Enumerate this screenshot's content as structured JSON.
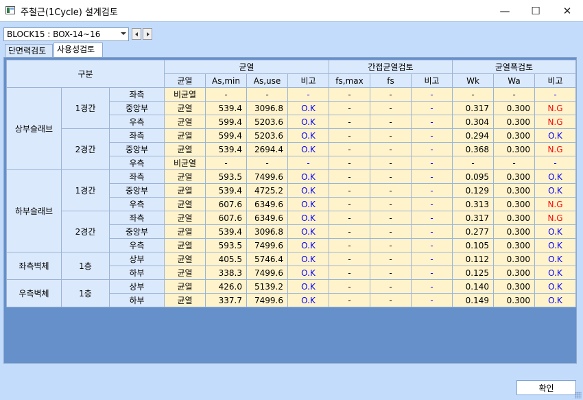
{
  "window": {
    "title": "주철근(1Cycle) 설계검토",
    "minimize": "—",
    "maximize": "☐",
    "close": "✕"
  },
  "block_select": {
    "value": "BLOCK15 : BOX-14~16"
  },
  "tabs": [
    "단면력검토",
    "사용성검토"
  ],
  "active_tab": 1,
  "headers": {
    "division": "구분",
    "crack": "균열",
    "indirect": "간접균열검토",
    "width": "균열폭검토",
    "sub": [
      "균열",
      "As,min",
      "As,use",
      "비고",
      "fs,max",
      "fs",
      "비고",
      "Wk",
      "Wa",
      "비고"
    ]
  },
  "groups": [
    {
      "name": "상부슬래브",
      "spans": [
        {
          "name": "1경간",
          "rows": [
            {
              "loc": "좌측",
              "c": "비균열",
              "asmin": "-",
              "asuse": "-",
              "r1": "-",
              "fsmax": "-",
              "fs": "-",
              "r2": "-",
              "wk": "-",
              "wa": "-",
              "r3": "-"
            },
            {
              "loc": "중앙부",
              "c": "균열",
              "asmin": "539.4",
              "asuse": "3096.8",
              "r1": "O.K",
              "fsmax": "-",
              "fs": "-",
              "r2": "-",
              "wk": "0.317",
              "wa": "0.300",
              "r3": "N.G"
            },
            {
              "loc": "우측",
              "c": "균열",
              "asmin": "599.4",
              "asuse": "5203.6",
              "r1": "O.K",
              "fsmax": "-",
              "fs": "-",
              "r2": "-",
              "wk": "0.304",
              "wa": "0.300",
              "r3": "N.G"
            }
          ]
        },
        {
          "name": "2경간",
          "rows": [
            {
              "loc": "좌측",
              "c": "균열",
              "asmin": "599.4",
              "asuse": "5203.6",
              "r1": "O.K",
              "fsmax": "-",
              "fs": "-",
              "r2": "-",
              "wk": "0.294",
              "wa": "0.300",
              "r3": "O.K"
            },
            {
              "loc": "중앙부",
              "c": "균열",
              "asmin": "539.4",
              "asuse": "2694.4",
              "r1": "O.K",
              "fsmax": "-",
              "fs": "-",
              "r2": "-",
              "wk": "0.368",
              "wa": "0.300",
              "r3": "N.G"
            },
            {
              "loc": "우측",
              "c": "비균열",
              "asmin": "-",
              "asuse": "-",
              "r1": "-",
              "fsmax": "-",
              "fs": "-",
              "r2": "-",
              "wk": "-",
              "wa": "-",
              "r3": "-"
            }
          ]
        }
      ]
    },
    {
      "name": "하부슬래브",
      "spans": [
        {
          "name": "1경간",
          "rows": [
            {
              "loc": "좌측",
              "c": "균열",
              "asmin": "593.5",
              "asuse": "7499.6",
              "r1": "O.K",
              "fsmax": "-",
              "fs": "-",
              "r2": "-",
              "wk": "0.095",
              "wa": "0.300",
              "r3": "O.K"
            },
            {
              "loc": "중앙부",
              "c": "균열",
              "asmin": "539.4",
              "asuse": "4725.2",
              "r1": "O.K",
              "fsmax": "-",
              "fs": "-",
              "r2": "-",
              "wk": "0.129",
              "wa": "0.300",
              "r3": "O.K"
            },
            {
              "loc": "우측",
              "c": "균열",
              "asmin": "607.6",
              "asuse": "6349.6",
              "r1": "O.K",
              "fsmax": "-",
              "fs": "-",
              "r2": "-",
              "wk": "0.313",
              "wa": "0.300",
              "r3": "N.G"
            }
          ]
        },
        {
          "name": "2경간",
          "rows": [
            {
              "loc": "좌측",
              "c": "균열",
              "asmin": "607.6",
              "asuse": "6349.6",
              "r1": "O.K",
              "fsmax": "-",
              "fs": "-",
              "r2": "-",
              "wk": "0.317",
              "wa": "0.300",
              "r3": "N.G"
            },
            {
              "loc": "중앙부",
              "c": "균열",
              "asmin": "539.4",
              "asuse": "3096.8",
              "r1": "O.K",
              "fsmax": "-",
              "fs": "-",
              "r2": "-",
              "wk": "0.277",
              "wa": "0.300",
              "r3": "O.K"
            },
            {
              "loc": "우측",
              "c": "균열",
              "asmin": "593.5",
              "asuse": "7499.6",
              "r1": "O.K",
              "fsmax": "-",
              "fs": "-",
              "r2": "-",
              "wk": "0.105",
              "wa": "0.300",
              "r3": "O.K"
            }
          ]
        }
      ]
    },
    {
      "name": "좌측벽체",
      "spans": [
        {
          "name": "1층",
          "rows": [
            {
              "loc": "상부",
              "c": "균열",
              "asmin": "405.5",
              "asuse": "5746.4",
              "r1": "O.K",
              "fsmax": "-",
              "fs": "-",
              "r2": "-",
              "wk": "0.112",
              "wa": "0.300",
              "r3": "O.K"
            },
            {
              "loc": "하부",
              "c": "균열",
              "asmin": "338.3",
              "asuse": "7499.6",
              "r1": "O.K",
              "fsmax": "-",
              "fs": "-",
              "r2": "-",
              "wk": "0.125",
              "wa": "0.300",
              "r3": "O.K"
            }
          ]
        }
      ]
    },
    {
      "name": "우측벽체",
      "spans": [
        {
          "name": "1층",
          "rows": [
            {
              "loc": "상부",
              "c": "균열",
              "asmin": "426.0",
              "asuse": "5139.2",
              "r1": "O.K",
              "fsmax": "-",
              "fs": "-",
              "r2": "-",
              "wk": "0.140",
              "wa": "0.300",
              "r3": "O.K"
            },
            {
              "loc": "하부",
              "c": "균열",
              "asmin": "337.7",
              "asuse": "7499.6",
              "r1": "O.K",
              "fsmax": "-",
              "fs": "-",
              "r2": "-",
              "wk": "0.149",
              "wa": "0.300",
              "r3": "O.K"
            }
          ]
        }
      ]
    }
  ],
  "confirm_label": "확인",
  "colors": {
    "ok": "#0000ff",
    "ng": "#ff0000",
    "header": "#dbe9fc",
    "cell": "#fff3cc",
    "client": "#c4dcfb",
    "empty_area": "#6590c9"
  }
}
